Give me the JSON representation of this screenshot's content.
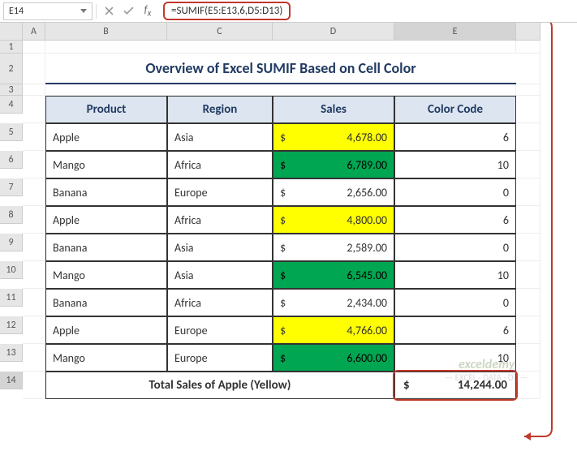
{
  "nameBox": "E14",
  "formula": "=SUMIF(E5:E13,6,D5:D13)",
  "columns": [
    "A",
    "B",
    "C",
    "D",
    "E",
    ""
  ],
  "rows": [
    "1",
    "2",
    "3",
    "4",
    "5",
    "6",
    "7",
    "8",
    "9",
    "10",
    "11",
    "12",
    "13",
    "14"
  ],
  "title": "Overview of Excel SUMIF Based on Cell Color",
  "headers": {
    "product": "Product",
    "region": "Region",
    "sales": "Sales",
    "color": "Color Code"
  },
  "data": [
    {
      "product": "Apple",
      "region": "Asia",
      "sales": "4,678.00",
      "color": "6",
      "fill": "yellow"
    },
    {
      "product": "Mango",
      "region": "Africa",
      "sales": "6,789.00",
      "color": "10",
      "fill": "green"
    },
    {
      "product": "Banana",
      "region": "Europe",
      "sales": "2,656.00",
      "color": "0",
      "fill": ""
    },
    {
      "product": "Apple",
      "region": "Africa",
      "sales": "4,800.00",
      "color": "6",
      "fill": "yellow"
    },
    {
      "product": "Banana",
      "region": "Asia",
      "sales": "2,589.00",
      "color": "0",
      "fill": ""
    },
    {
      "product": "Mango",
      "region": "Asia",
      "sales": "6,545.00",
      "color": "10",
      "fill": "green"
    },
    {
      "product": "Banana",
      "region": "Africa",
      "sales": "2,434.00",
      "color": "0",
      "fill": ""
    },
    {
      "product": "Apple",
      "region": "Europe",
      "sales": "4,766.00",
      "color": "6",
      "fill": "yellow"
    },
    {
      "product": "Mango",
      "region": "Europe",
      "sales": "6,600.00",
      "color": "10",
      "fill": "green"
    }
  ],
  "currency": "$",
  "totalLabel": "Total Sales of Apple (Yellow)",
  "totalValue": "14,244.00",
  "watermark": {
    "title": "exceldemy",
    "sub": "— EXCEL · DATA · DB —"
  },
  "chart_data": {
    "type": "table",
    "title": "Overview of Excel SUMIF Based on Cell Color",
    "columns": [
      "Product",
      "Region",
      "Sales",
      "Color Code"
    ],
    "rows": [
      [
        "Apple",
        "Asia",
        4678.0,
        6
      ],
      [
        "Mango",
        "Africa",
        6789.0,
        10
      ],
      [
        "Banana",
        "Europe",
        2656.0,
        0
      ],
      [
        "Apple",
        "Africa",
        4800.0,
        6
      ],
      [
        "Banana",
        "Asia",
        2589.0,
        0
      ],
      [
        "Mango",
        "Asia",
        6545.0,
        10
      ],
      [
        "Banana",
        "Africa",
        2434.0,
        0
      ],
      [
        "Apple",
        "Europe",
        4766.0,
        6
      ],
      [
        "Mango",
        "Europe",
        6600.0,
        10
      ]
    ],
    "summary": {
      "label": "Total Sales of Apple (Yellow)",
      "value": 14244.0
    }
  }
}
